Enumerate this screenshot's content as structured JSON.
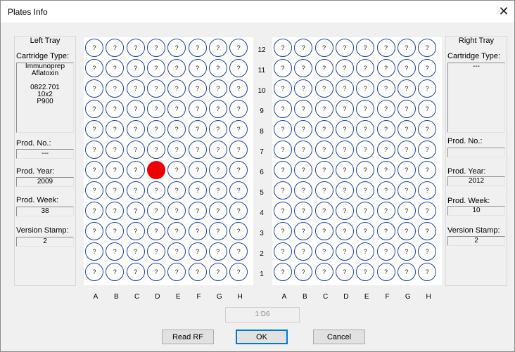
{
  "window": {
    "title": "Plates Info",
    "close_icon": "close-icon"
  },
  "left_tray": {
    "title": "Left Tray",
    "cartridge_type_label": "Cartridge Type:",
    "cartridge_lines": [
      "Immunoprep",
      "Aflatoxin",
      "",
      "0822.701",
      "10x2",
      "P900"
    ],
    "prod_no_label": "Prod. No.:",
    "prod_no": "---",
    "prod_year_label": "Prod. Year:",
    "prod_year": "2009",
    "prod_week_label": "Prod. Week:",
    "prod_week": "38",
    "version_stamp_label": "Version Stamp:",
    "version_stamp": "2"
  },
  "right_tray": {
    "title": "Right Tray",
    "cartridge_type_label": "Cartridge Type:",
    "cartridge_lines": [
      "---"
    ],
    "prod_no_label": "Prod. No.:",
    "prod_no": "",
    "prod_year_label": "Prod. Year:",
    "prod_year": "2012",
    "prod_week_label": "Prod. Week:",
    "prod_week": "10",
    "version_stamp_label": "Version Stamp:",
    "version_stamp": "2"
  },
  "plate": {
    "columns": [
      "A",
      "B",
      "C",
      "D",
      "E",
      "F",
      "G",
      "H"
    ],
    "rows": [
      "12",
      "11",
      "10",
      "9",
      "8",
      "7",
      "6",
      "5",
      "4",
      "3",
      "2",
      "1"
    ],
    "well_symbol": "?",
    "selected_well": {
      "plate": "left",
      "column": "D",
      "row": "6"
    },
    "selected_color": "#f00000",
    "well_border_color": "#1f3fb0"
  },
  "selection_display": "1:D6",
  "buttons": {
    "read_rf": "Read RF",
    "ok": "OK",
    "cancel": "Cancel"
  }
}
